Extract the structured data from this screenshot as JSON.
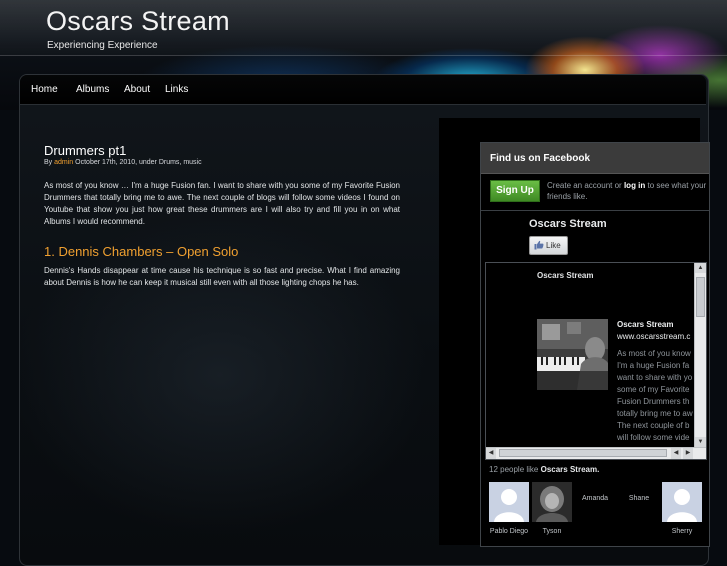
{
  "site": {
    "title": "Oscars Stream",
    "tagline": "Experiencing Experience"
  },
  "nav": {
    "items": [
      "Home",
      "Albums",
      "About",
      "Links"
    ]
  },
  "post": {
    "title": "Drummers pt1",
    "meta": {
      "by": "By",
      "author": "admin",
      "rest": "October 17th, 2010, under Drums, music"
    },
    "intro": "As most of you know … I'm a huge Fusion fan. I want to share with you some of my Favorite Fusion Drummers that totally bring me to awe. The next couple of blogs will follow some videos I found on Youtube that show you just how great these drummers are I will also try and fill you in on what Albums I would recommend.",
    "section_heading": "1. Dennis Chambers – Open Solo",
    "section_text": "Dennis's Hands disappear at time cause his technique is so fast and precise. What I find amazing about Dennis is how he can keep it musical still even with all those lighting chops he has."
  },
  "facebook": {
    "header": "Find us on Facebook",
    "signup_label": "Sign Up",
    "signup_text_before": "Create an account or",
    "signup_login": "log in",
    "signup_text_after": "to see what your friends like.",
    "page_name": "Oscars Stream",
    "like_label": "Like",
    "stream": {
      "page_name": "Oscars Stream",
      "entry_name": "Oscars Stream",
      "entry_url": "www.oscarsstream.c",
      "entry_lines": [
        "As most of you know",
        "I'm a huge Fusion fa",
        "want to share with yo",
        "some of my Favorite",
        "Fusion Drummers th",
        "totally bring me to aw",
        "The next couple of b",
        "will follow some vide"
      ]
    },
    "likes_prefix": "12 people like",
    "likes_page": "Oscars Stream.",
    "fans": [
      {
        "name": "Pablo Diego",
        "photo": "silhouette"
      },
      {
        "name": "Tyson",
        "photo": "photo"
      },
      {
        "name": "Amanda",
        "photo": "none"
      },
      {
        "name": "Shane",
        "photo": "none"
      },
      {
        "name": "Sherry",
        "photo": "silhouette"
      }
    ]
  },
  "colors": {
    "accent": "#f0a030",
    "signup_green": "#4ea12e",
    "background": "#070b10"
  },
  "icons": {
    "like": "thumbs-up-icon",
    "scroll_up": "arrow-up-icon",
    "scroll_down": "arrow-down-icon",
    "scroll_left": "arrow-left-icon",
    "scroll_right": "arrow-right-icon"
  }
}
